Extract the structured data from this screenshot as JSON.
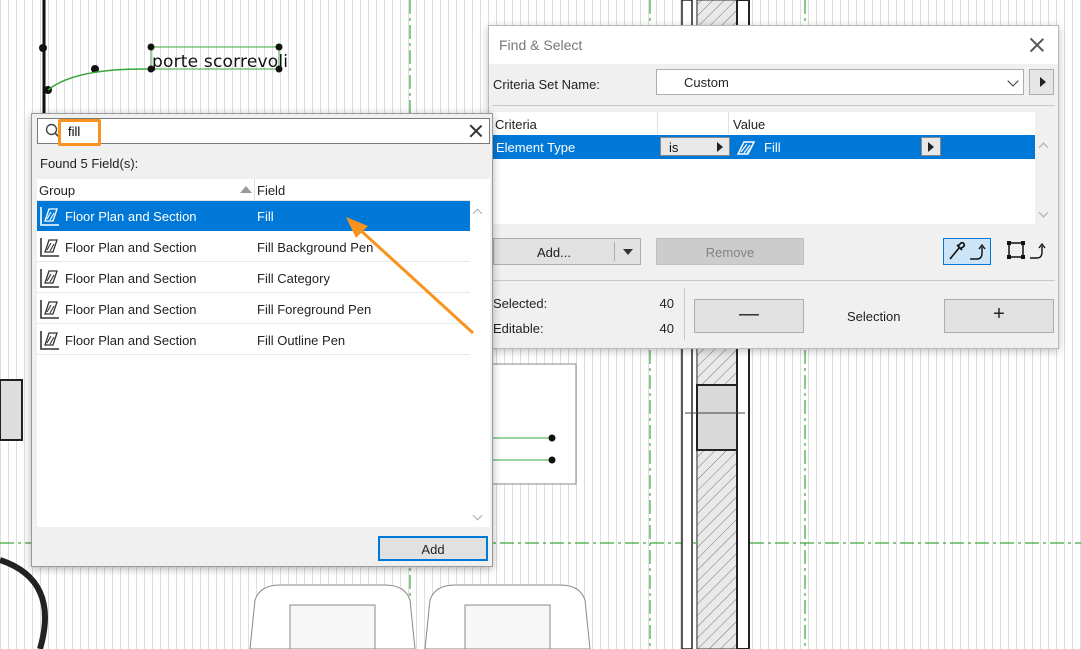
{
  "canvas": {
    "label": "porte scorrevoli"
  },
  "find_select": {
    "title": "Find & Select",
    "criteria_set_label": "Criteria Set Name:",
    "criteria_set_value": "Custom",
    "table": {
      "headers": [
        "Criteria",
        "",
        "Value"
      ],
      "row": {
        "criteria": "Element Type",
        "operator": "is",
        "value": "Fill"
      }
    },
    "add_label": "Add...",
    "remove_label": "Remove",
    "selected_label": "Selected:",
    "selected_value": "40",
    "editable_label": "Editable:",
    "editable_value": "40",
    "minus_label": "—",
    "selection_label": "Selection",
    "plus_label": "+"
  },
  "field_popup": {
    "search_value": "fill",
    "found_text": "Found 5 Field(s):",
    "header_group": "Group",
    "header_field": "Field",
    "rows": [
      {
        "group": "Floor Plan and Section",
        "field": "Fill",
        "selected": true
      },
      {
        "group": "Floor Plan and Section",
        "field": "Fill Background Pen",
        "selected": false
      },
      {
        "group": "Floor Plan and Section",
        "field": "Fill Category",
        "selected": false
      },
      {
        "group": "Floor Plan and Section",
        "field": "Fill Foreground Pen",
        "selected": false
      },
      {
        "group": "Floor Plan and Section",
        "field": "Fill Outline Pen",
        "selected": false
      }
    ],
    "add_label": "Add"
  },
  "colors": {
    "selection": "#0078d7",
    "highlight": "#f7931e",
    "guide_line": "#3aa63a"
  }
}
